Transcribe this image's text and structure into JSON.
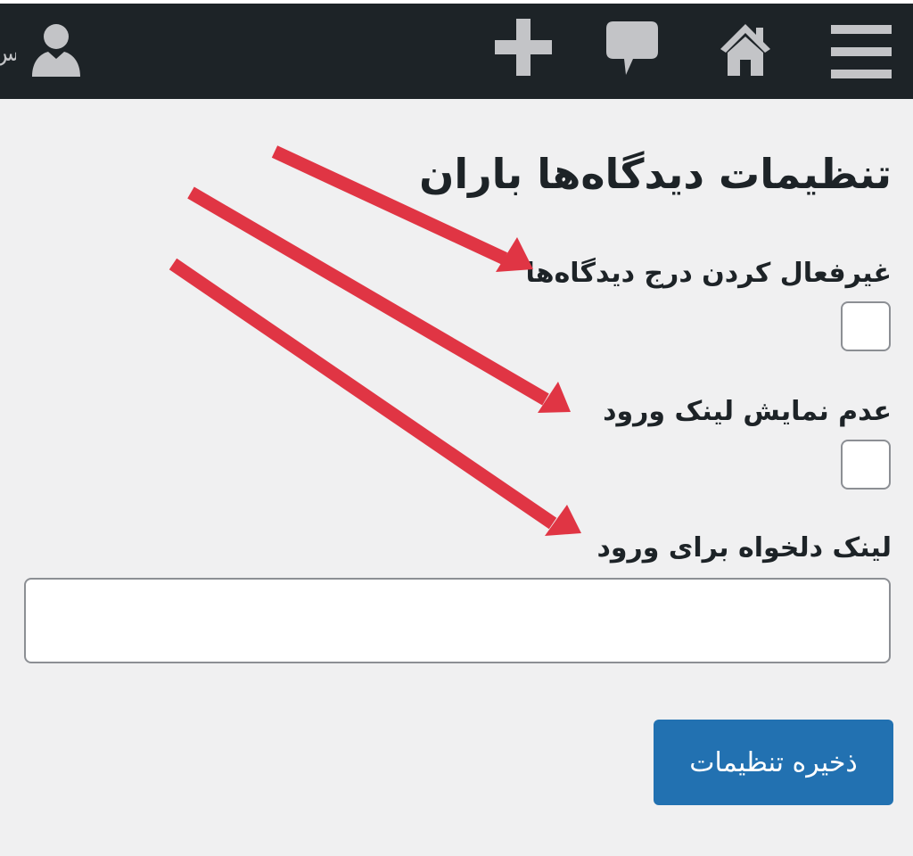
{
  "admin_bar": {
    "user_text_cut": "س",
    "icons": [
      "user-icon",
      "plus-icon",
      "comment-icon",
      "home-icon",
      "menu-icon"
    ],
    "bar_color": "#1d2327",
    "icon_color": "#c3c4c7"
  },
  "page": {
    "title": "تنظیمات دیدگاه‌ها باران",
    "fields": [
      {
        "label": "غیرفعال کردن درج دیدگاه‌ها",
        "type": "checkbox",
        "checked": false
      },
      {
        "label": "عدم نمایش لینک ورود",
        "type": "checkbox",
        "checked": false
      },
      {
        "label": "لینک دلخواه برای ورود",
        "type": "text",
        "value": ""
      }
    ],
    "save_button_label": "ذخیره تنظیمات",
    "button_color": "#2271b1",
    "background_color": "#f0f0f1"
  },
  "annotations": {
    "arrow_color": "#e03544",
    "arrow_count": 3
  }
}
